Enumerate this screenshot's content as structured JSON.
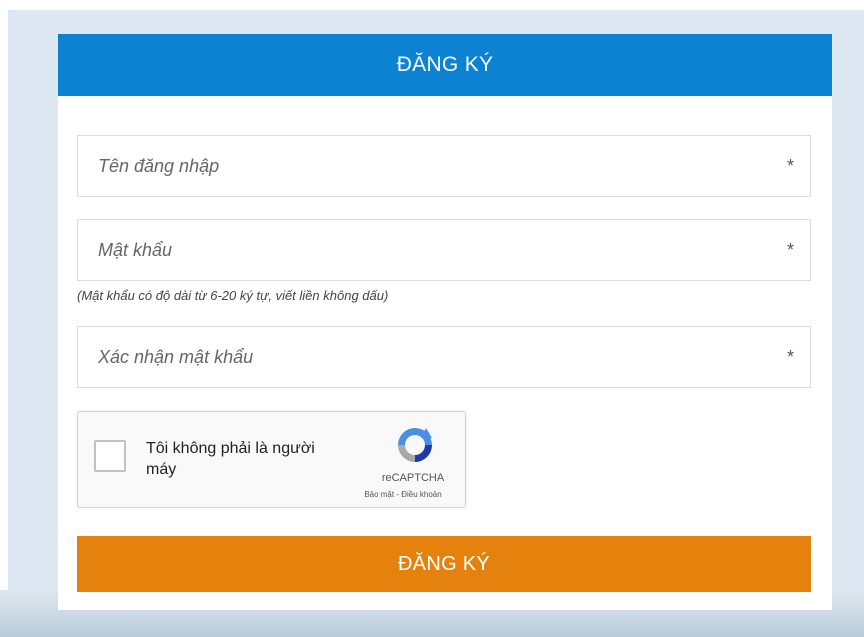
{
  "form": {
    "title": "ĐĂNG KÝ",
    "fields": [
      {
        "placeholder": "Tên đăng nhập",
        "required_mark": "*"
      },
      {
        "placeholder": "Mật khẩu",
        "required_mark": "*"
      },
      {
        "placeholder": "Xác nhận mật khẩu",
        "required_mark": "*"
      }
    ],
    "password_hint": "(Mật khẩu có độ dài từ 6-20 ký tự, viết liền không dấu)",
    "submit_label": "ĐĂNG KÝ"
  },
  "captcha": {
    "label": "Tôi không phải là người máy",
    "brand": "reCAPTCHA",
    "links": "Bảo mật - Điều khoản",
    "checked": false
  },
  "colors": {
    "header": "#0c82d2",
    "submit": "#e5820e",
    "background": "#dde8f2"
  },
  "icons": [
    "recaptcha-logo-icon"
  ]
}
